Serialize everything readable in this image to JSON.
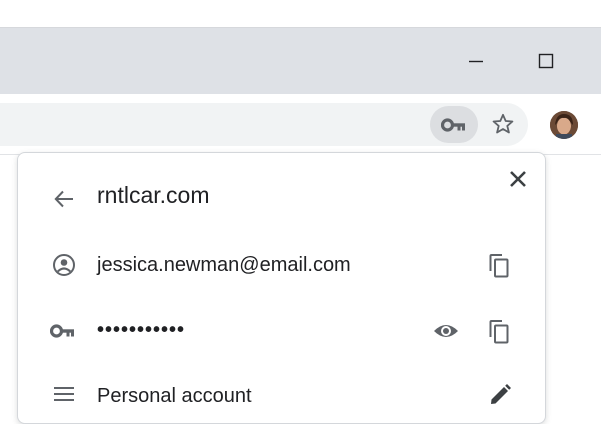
{
  "window": {
    "minimize_icon": "minimize-icon",
    "maximize_icon": "maximize-icon"
  },
  "toolbar": {
    "key_icon": "key-icon",
    "bookmark_icon": "star-icon",
    "avatar": "profile-avatar"
  },
  "password_bubble": {
    "site": "rntlcar.com",
    "username": "jessica.newman@email.com",
    "password_masked": "•••••••••••",
    "note": "Personal account",
    "icons": {
      "back": "back-arrow-icon",
      "close": "close-icon",
      "account": "account-circle-icon",
      "copy": "copy-icon",
      "key": "key-icon",
      "show_password": "eye-icon",
      "note": "menu-lines-icon",
      "edit": "pencil-icon"
    }
  },
  "colors": {
    "titlebar": "#dee1e6",
    "omnibox": "#f1f3f4",
    "key_chip": "#dcdee1",
    "text": "#202124",
    "icon": "#5f6368"
  }
}
